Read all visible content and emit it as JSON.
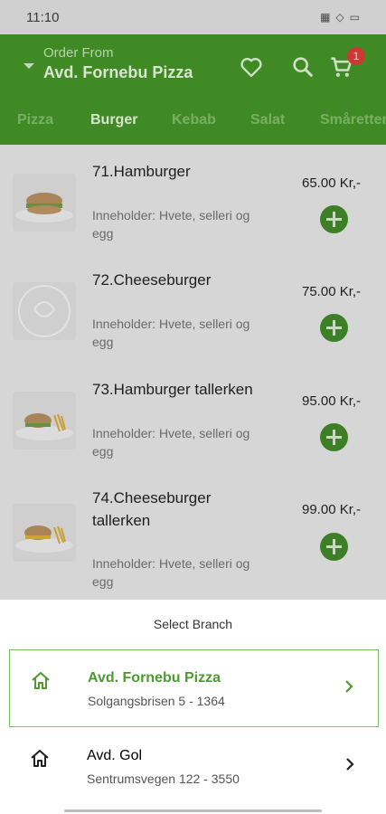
{
  "status_bar": {
    "time": "11:10"
  },
  "header": {
    "order_from_label": "Order From",
    "current_branch": "Avd. Fornebu Pizza",
    "cart_count": "1"
  },
  "tabs": [
    "Pizza",
    "Burger",
    "Kebab",
    "Salat",
    "Småretter"
  ],
  "active_tab": "Burger",
  "products": [
    {
      "name": "71.Hamburger",
      "description": "Inneholder: Hvete, selleri og egg",
      "price": "65.00 Kr,-"
    },
    {
      "name": "72.Cheeseburger",
      "description": "Inneholder: Hvete, selleri og egg",
      "price": "75.00 Kr,-"
    },
    {
      "name": "73.Hamburger tallerken",
      "description": "Inneholder: Hvete, selleri og egg",
      "price": "95.00 Kr,-"
    },
    {
      "name": "74.Cheeseburger tallerken",
      "description": "Inneholder: Hvete, selleri og egg",
      "price": "99.00 Kr,-"
    }
  ],
  "sheet": {
    "title": "Select Branch",
    "branches": [
      {
        "name": "Avd. Fornebu Pizza",
        "address": "Solgangsbrisen 5 - 1364",
        "selected": true
      },
      {
        "name": "Avd. Gol",
        "address": "Sentrumsvegen 122 - 3550",
        "selected": false
      }
    ]
  },
  "colors": {
    "brand_green": "#4d9a31",
    "selected_border": "#7cbf64",
    "badge_red": "#c93a33"
  }
}
